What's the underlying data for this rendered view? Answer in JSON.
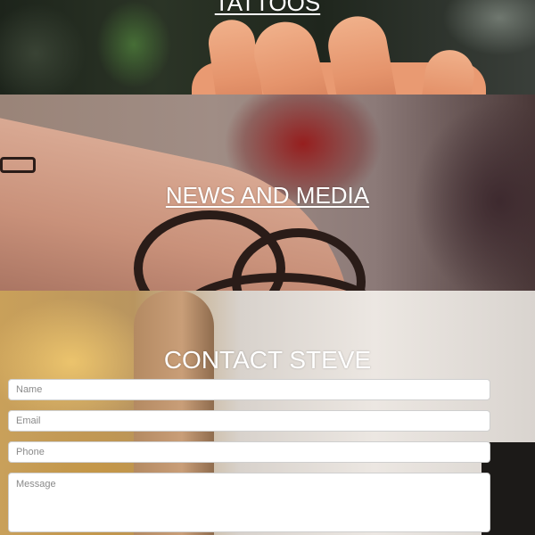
{
  "sections": {
    "tattoos": {
      "title": "TATTOOS"
    },
    "news": {
      "title": "NEWS AND MEDIA"
    },
    "contact": {
      "title": "CONTACT STEVE",
      "form": {
        "name_placeholder": "Name",
        "email_placeholder": "Email",
        "phone_placeholder": "Phone",
        "message_placeholder": "Message"
      }
    }
  }
}
